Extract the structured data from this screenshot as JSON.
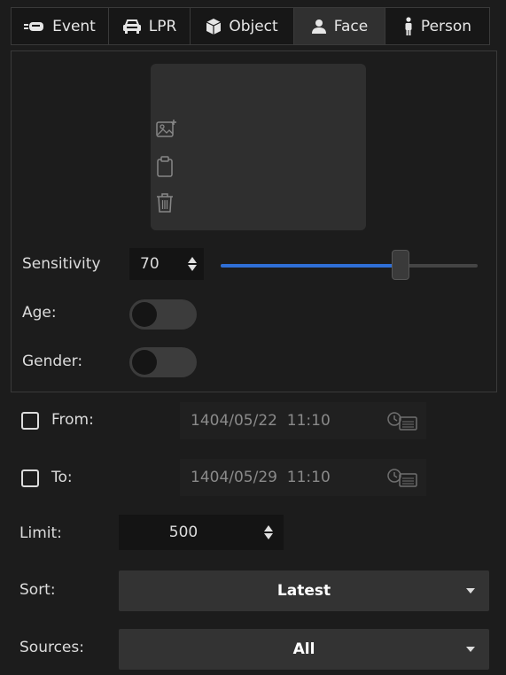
{
  "tabs": [
    {
      "label": "Event",
      "icon": "event-icon",
      "active": false
    },
    {
      "label": "LPR",
      "icon": "car-icon",
      "active": false
    },
    {
      "label": "Object",
      "icon": "cube-icon",
      "active": false
    },
    {
      "label": "Face",
      "icon": "person-icon",
      "active": true
    },
    {
      "label": "Person",
      "icon": "standing-person-icon",
      "active": false
    }
  ],
  "face": {
    "sensitivity_label": "Sensitivity",
    "sensitivity_value": "70",
    "sensitivity_level": 0.7,
    "age_label": "Age:",
    "age_enabled": false,
    "gender_label": "Gender:",
    "gender_enabled": false
  },
  "filters": {
    "from_label": "From:",
    "from_value": "1404/05/22  11:10",
    "to_label": "To:",
    "to_value": "1404/05/29  11:10",
    "limit_label": "Limit:",
    "limit_value": "500",
    "sort_label": "Sort:",
    "sort_value": "Latest",
    "sources_label": "Sources:",
    "sources_value": "All"
  },
  "colors": {
    "accent": "#2f6fd6",
    "background": "#1c1c1c",
    "active_tab": "#303030"
  }
}
